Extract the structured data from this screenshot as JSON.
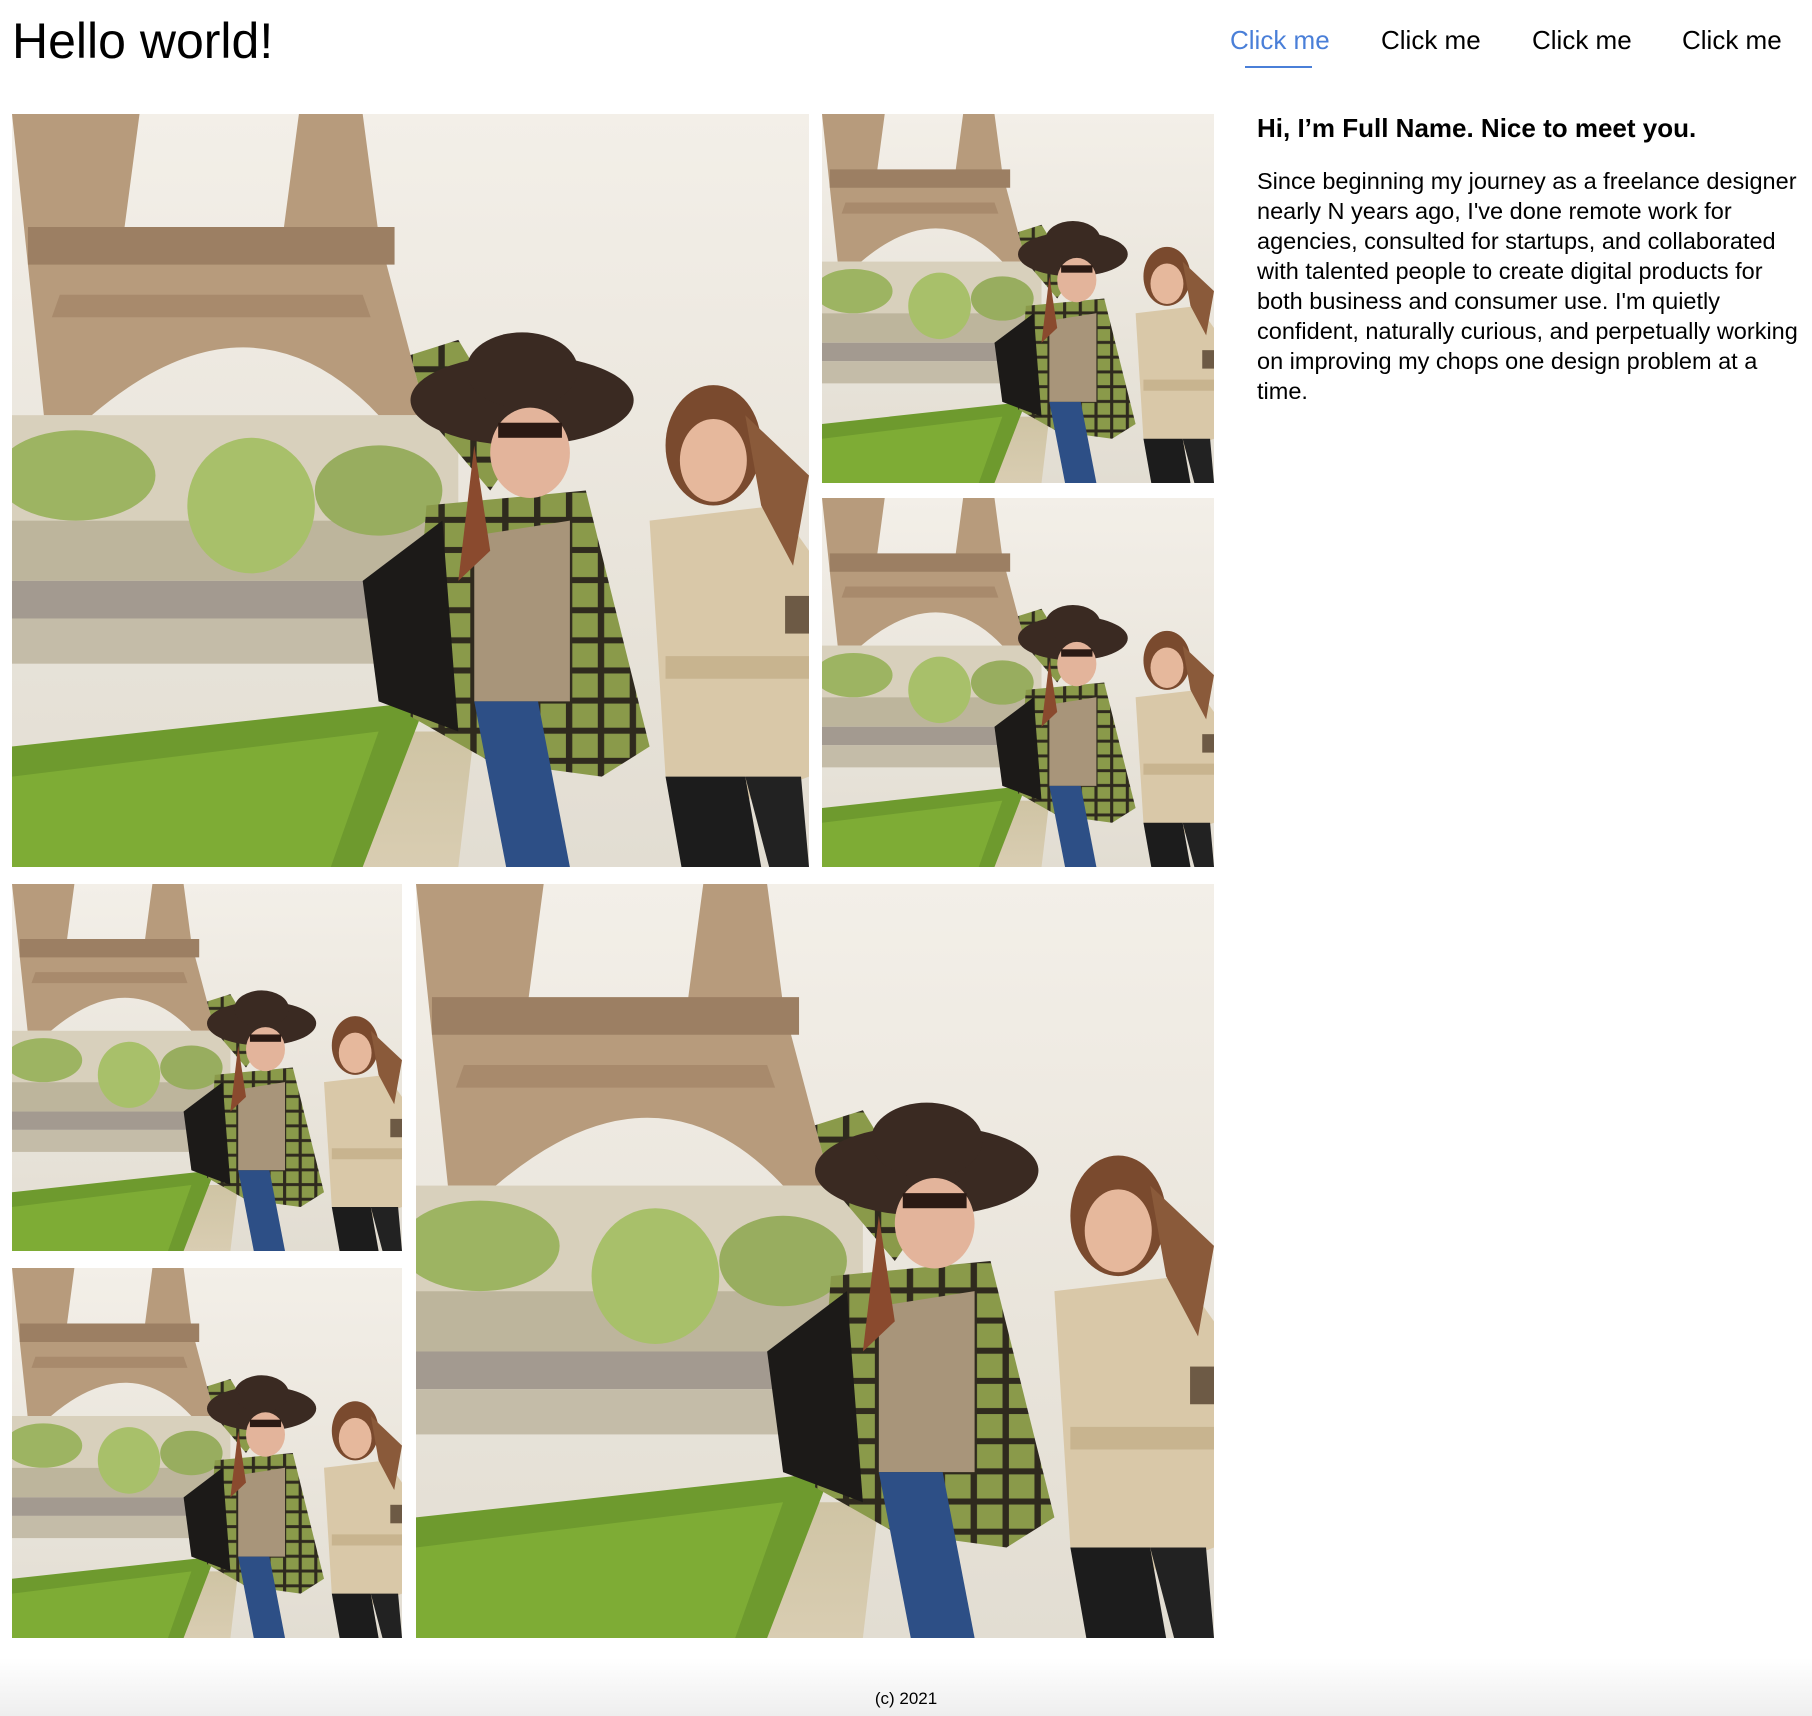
{
  "header": {
    "title": "Hello world!"
  },
  "nav": {
    "items": [
      {
        "label": "Click me",
        "active": true
      },
      {
        "label": "Click me",
        "active": false
      },
      {
        "label": "Click me",
        "active": false
      },
      {
        "label": "Click me",
        "active": false
      }
    ],
    "accent_color": "#4a7fd8"
  },
  "intro": {
    "heading": "Hi, I’m Full Name. Nice to meet you.",
    "body": "Since beginning my journey as a freelance designer nearly N years ago, I've done remote work for agencies, consulted for startups, and collaborated with talented people to create digital products for both business and consumer use. I'm quietly confident, naturally curious, and perpetually working on improving my chops one design problem at a time."
  },
  "gallery": {
    "photo_subject": "eiffel-tower-friends-photo"
  },
  "footer": {
    "text": "(c) 2021"
  }
}
